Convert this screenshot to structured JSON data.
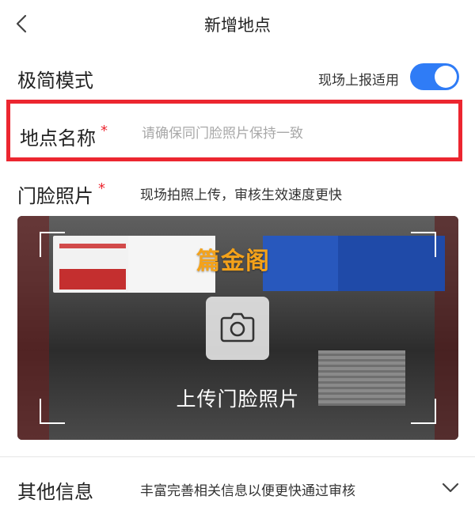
{
  "nav": {
    "title": "新增地点",
    "back_icon": "chevron-left-icon"
  },
  "simple_mode": {
    "label": "极简模式",
    "hint": "现场上报适用",
    "toggle_on": true,
    "toggle_color": "#2f7cf6"
  },
  "location_name": {
    "label": "地点名称",
    "required_mark": "*",
    "value": "",
    "placeholder": "请确保同门脸照片保持一致"
  },
  "storefront_photo": {
    "label": "门脸照片",
    "required_mark": "*",
    "hint": "现场拍照上传，审核生效速度更快",
    "upload_label": "上传门脸照片",
    "watermark": "篇金阁",
    "camera_icon": "camera-icon"
  },
  "other_info": {
    "label": "其他信息",
    "hint": "丰富完善相关信息以便更快通过审核",
    "expand_icon": "chevron-down-icon"
  },
  "colors": {
    "accent": "#2f7cf6",
    "highlight_border": "#ec2630",
    "required": "#ec2630"
  }
}
